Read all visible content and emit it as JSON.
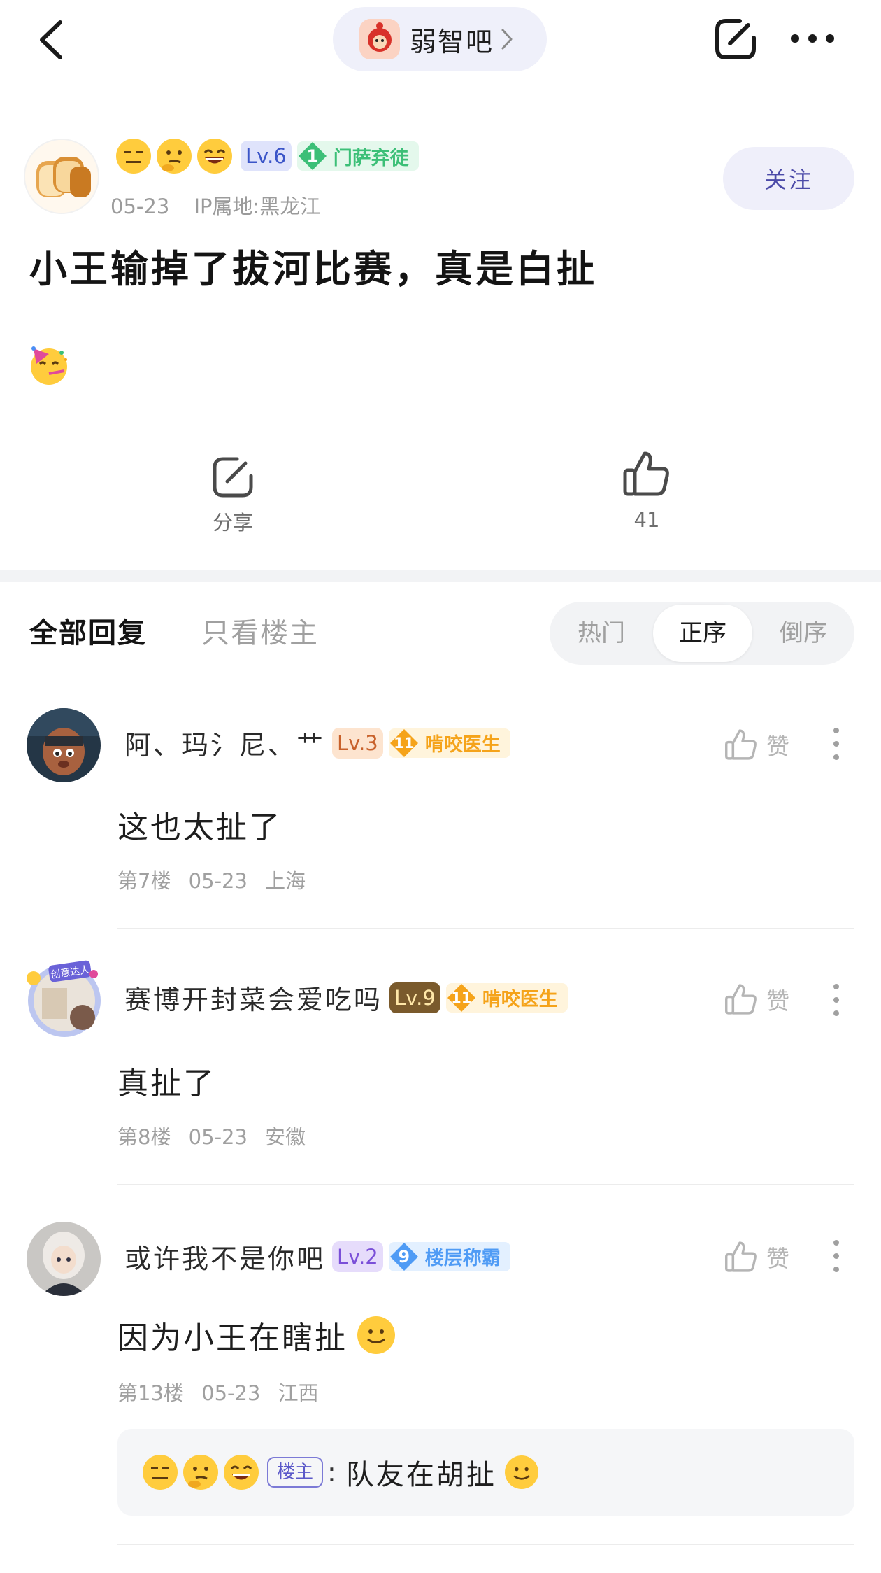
{
  "topbar": {
    "forum_name": "弱智吧"
  },
  "post": {
    "author": {
      "level": "Lv.6",
      "honor_level": "1",
      "honor_title": "门萨弃徒",
      "date": "05-23",
      "ip_location": "IP属地:黑龙江"
    },
    "follow_label": "关注",
    "title": "小王输掉了拔河比赛，真是白扯",
    "actions": {
      "share_label": "分享",
      "like_count": "41"
    }
  },
  "replies_header": {
    "tab_all": "全部回复",
    "tab_op_only": "只看楼主",
    "sort_options": [
      "热门",
      "正序",
      "倒序"
    ],
    "sort_selected": "正序"
  },
  "comments": [
    {
      "username": "阿、玛氵尼、艹",
      "level": "Lv.3",
      "honor_level": "11",
      "honor_title": "啃咬医生",
      "text": "这也太扯了",
      "floor": "第7楼",
      "date": "05-23",
      "location": "上海",
      "like_label": "赞"
    },
    {
      "username": "赛博开封菜会爱吃吗",
      "level": "Lv.9",
      "honor_level": "11",
      "honor_title": "啃咬医生",
      "avatar_frame_text": "创意达人",
      "text": "真扯了",
      "floor": "第8楼",
      "date": "05-23",
      "location": "安徽",
      "like_label": "赞"
    },
    {
      "username": "或许我不是你吧",
      "level": "Lv.2",
      "honor_level": "9",
      "honor_title": "楼层称霸",
      "text": "因为小王在瞎扯",
      "floor": "第13楼",
      "date": "05-23",
      "location": "江西",
      "like_label": "赞",
      "sub_reply": {
        "op_tag": "楼主",
        "separator": ":",
        "text": "队友在胡扯"
      }
    }
  ],
  "colors": {
    "accent": "#4b4aa8",
    "follow_bg": "#efeffa",
    "honor_green": "#3cbf77",
    "honor_orange": "#f5a31a",
    "honor_blue": "#4f9bf5"
  }
}
